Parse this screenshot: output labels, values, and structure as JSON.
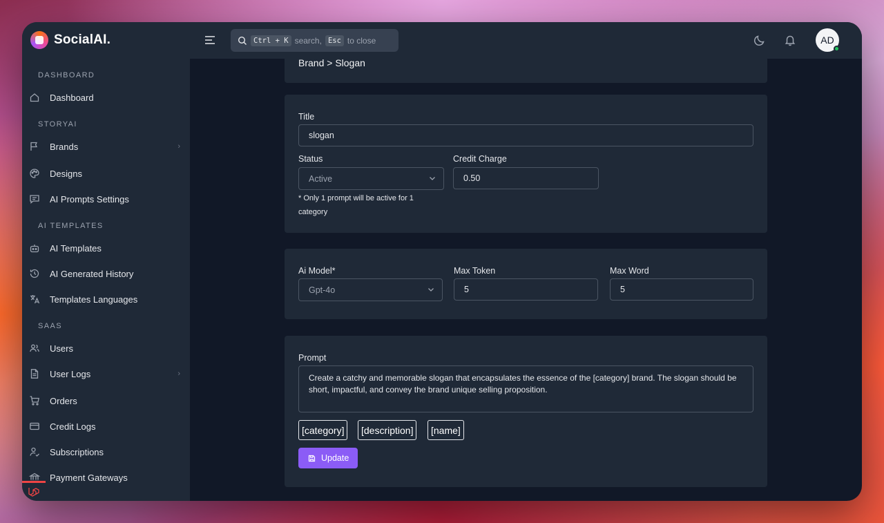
{
  "app": {
    "name": "SocialAI."
  },
  "topbar": {
    "search_prefix_kbd": "Ctrl + K",
    "search_mid": "search,",
    "search_close_kbd": "Esc",
    "search_suffix": "to close",
    "avatar_initials": "AD"
  },
  "sidebar": {
    "sections": {
      "dashboard": "DASHBOARD",
      "storyai": "STORYAI",
      "ai_templates": "AI TEMPLATES",
      "saas": "SAAS"
    },
    "items": {
      "dashboard": "Dashboard",
      "brands": "Brands",
      "designs": "Designs",
      "ai_prompts_settings": "AI Prompts Settings",
      "ai_templates": "AI Templates",
      "ai_generated_history": "AI Generated History",
      "templates_languages": "Templates Languages",
      "users": "Users",
      "user_logs": "User Logs",
      "orders": "Orders",
      "credit_logs": "Credit Logs",
      "subscriptions": "Subscriptions",
      "payment_gateways": "Payment Gateways"
    }
  },
  "breadcrumb": "Brand > Slogan",
  "form": {
    "title_label": "Title",
    "title_value": "slogan",
    "status_label": "Status",
    "status_value": "Active",
    "credit_label": "Credit Charge",
    "credit_value": "0.50",
    "status_note_line1": "* Only 1 prompt will be active for 1",
    "status_note_line2": "category",
    "model_label": "Ai Model*",
    "model_value": "Gpt-4o",
    "max_token_label": "Max Token",
    "max_token_value": "5",
    "max_word_label": "Max Word",
    "max_word_value": "5",
    "prompt_label": "Prompt",
    "prompt_value": "Create a catchy and memorable slogan that encapsulates the essence of the [category] brand. The slogan should be short, impactful, and convey the brand unique selling proposition.",
    "tags": [
      "[category]",
      "[description]",
      "[name]"
    ],
    "update_label": "Update"
  }
}
